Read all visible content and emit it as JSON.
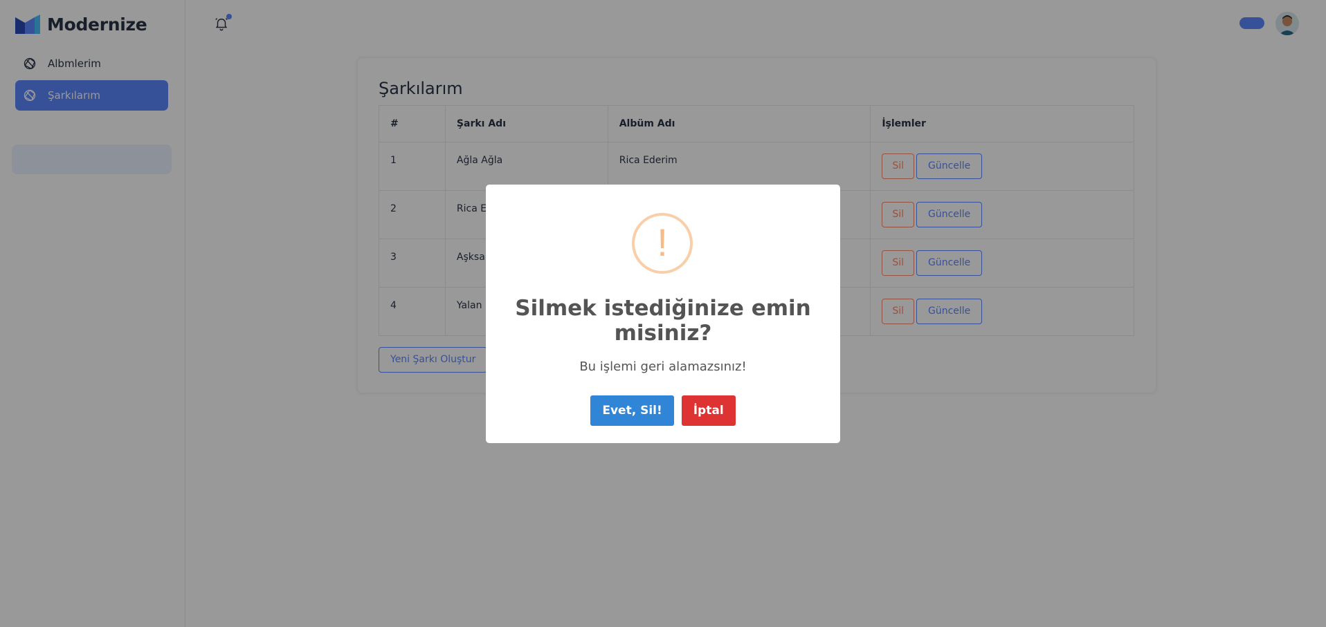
{
  "brand": {
    "name": "Modernize"
  },
  "sidebar": {
    "items": [
      {
        "label": "Albmlerim",
        "active": false
      },
      {
        "label": "Şarkılarım",
        "active": true
      }
    ]
  },
  "colors": {
    "primary": "#5d87ff",
    "danger_outline": "#fa896b",
    "confirm": "#3085d6",
    "cancel": "#dd3333",
    "warning": "#f8bb86"
  },
  "main": {
    "title": "Şarkılarım",
    "table": {
      "headers": [
        "#",
        "Şarkı Adı",
        "Albüm Adı",
        "İşlemler"
      ],
      "rows": [
        {
          "num": "1",
          "song": "Ağla Ağla",
          "album": "Rica Ederim"
        },
        {
          "num": "2",
          "song": "Rica Ederim",
          "album": ""
        },
        {
          "num": "3",
          "song": "Aşksa",
          "album": ""
        },
        {
          "num": "4",
          "song": "Yalan",
          "album": ""
        }
      ],
      "delete_label": "Sil",
      "update_label": "Güncelle"
    },
    "new_button": "Yeni Şarkı Oluştur"
  },
  "modal": {
    "icon": "warning-icon",
    "title": "Silmek istediğinize emin misiniz?",
    "text": "Bu işlemi geri alamazsınız!",
    "confirm": "Evet, Sil!",
    "cancel": "İptal"
  }
}
